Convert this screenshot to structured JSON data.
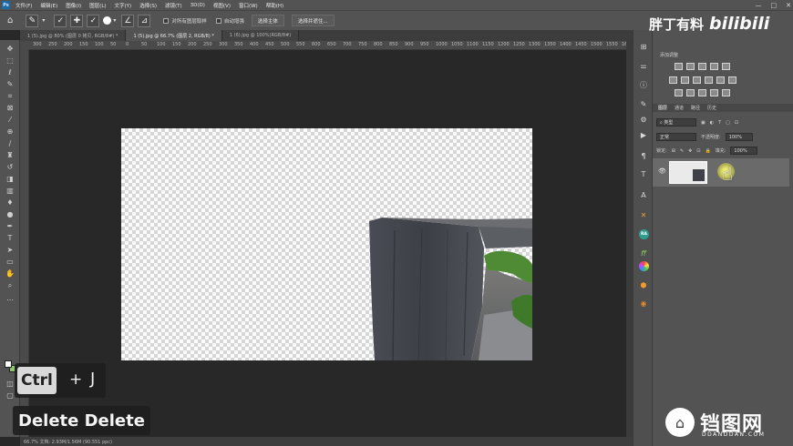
{
  "app": {
    "logo": "Ps",
    "menu": [
      "文件(F)",
      "编辑(E)",
      "图像(I)",
      "图层(L)",
      "文字(Y)",
      "选择(S)",
      "滤镜(T)",
      "3D(D)",
      "视图(V)",
      "窗口(W)",
      "帮助(H)"
    ],
    "window_controls": [
      "—",
      "□",
      "✕"
    ]
  },
  "options_bar": {
    "sample_all_layers": "对所有图层取样",
    "auto_enhance": "自动增强",
    "select_subject": "选择主体",
    "select_and_mask": "选择并遮住..."
  },
  "tabs": [
    {
      "label": "1 (5).jpg @ 80% (图层 0 拷贝, RGB/8#) *"
    },
    {
      "label": "1 (5).jpg @ 66.7% (图层 2, RGB/8) *",
      "active": true
    },
    {
      "label": "1 (6).jpg @ 100%(RGB/8#)"
    }
  ],
  "ruler_ticks": [
    "300",
    "250",
    "200",
    "150",
    "100",
    "50",
    "0",
    "50",
    "100",
    "150",
    "200",
    "250",
    "300",
    "350",
    "400",
    "450",
    "500",
    "550",
    "600",
    "650",
    "700",
    "750",
    "800",
    "850",
    "900",
    "950",
    "1000",
    "1050",
    "1100",
    "1150",
    "1200",
    "1250",
    "1300",
    "1350",
    "1400",
    "1450",
    "1500",
    "1550",
    "1600"
  ],
  "status": "66.7%   文档: 2.93M/1.56M   (90.551 ppc)",
  "panels": {
    "adjustments_title": "添加调整",
    "layers_tabs": [
      "图层",
      "通道",
      "路径",
      "历史"
    ],
    "kind_label": "类型",
    "blend_mode": "正常",
    "opacity_label": "不透明度:",
    "opacity_value": "100%",
    "lock_label": "锁定:",
    "fill_label": "填充:",
    "fill_value": "100%"
  },
  "watermark": {
    "top_cn": "胖丁有料",
    "top_bili": "bilibili",
    "bottom_cn": "铛图网",
    "bottom_en": "DDANDDAN.COM"
  },
  "shortcut": {
    "key1": "Ctrl",
    "plus": "+",
    "key2": "J",
    "action": "Delete Delete"
  },
  "colors": {
    "foreground": "#ffffff",
    "background": "#8ec56d"
  }
}
